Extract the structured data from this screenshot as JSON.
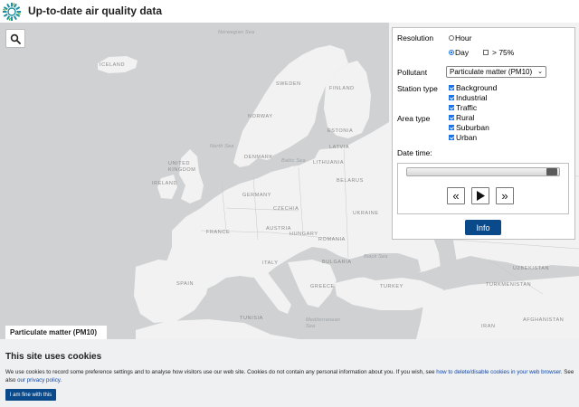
{
  "header": {
    "title": "Up-to-date air quality data"
  },
  "map": {
    "labels": {
      "iceland": "ICELAND",
      "sweden": "SWEDEN",
      "finland": "FINLAND",
      "norway": "NORWAY",
      "estonia": "ESTONIA",
      "latvia": "LATVIA",
      "lithuania": "LITHUANIA",
      "denmark": "DENMARK",
      "uk": "UNITED KINGDOM",
      "ireland": "IRELAND",
      "belarus": "BELARUS",
      "germany": "GERMANY",
      "czechia": "CZECHIA",
      "ukraine": "UKRAINE",
      "france": "FRANCE",
      "austria": "AUSTRIA",
      "hungary": "HUNGARY",
      "romania": "ROMANIA",
      "bulgaria": "BULGARIA",
      "spain": "SPAIN",
      "italy": "ITALY",
      "greece": "GREECE",
      "turkey": "TURKEY",
      "tunisia": "TUNISIA",
      "uzbekistan": "UZBEKISTAN",
      "turkmenistan": "TURKMENISTAN",
      "iran": "IRAN",
      "afghanistan": "AFGHANISTAN",
      "norwegian_sea": "Norwegian Sea",
      "north_sea": "North Sea",
      "baltic_sea": "Baltic Sea",
      "black_sea": "Black Sea",
      "mediterranean": "Mediterranean Sea"
    },
    "layer_label": "Particulate matter (PM10)"
  },
  "panel": {
    "resolution_label": "Resolution",
    "hour_label": "Hour",
    "day_label": "Day",
    "over75_label": "> 75%",
    "pollutant_label": "Pollutant",
    "pollutant_value": "Particulate matter (PM10)",
    "station_type_label": "Station type",
    "station_types": [
      "Background",
      "Industrial",
      "Traffic"
    ],
    "area_type_label": "Area type",
    "area_types": [
      "Rural",
      "Suburban",
      "Urban"
    ],
    "datetime_label": "Date time:",
    "slider_position": 1.0,
    "prev_label": "«",
    "play_label": "▶",
    "next_label": "»",
    "info_label": "Info",
    "resolution_selected": "Day",
    "over75_checked": false
  },
  "cookie": {
    "title": "This site uses cookies",
    "text_before": "We use cookies to record some preference settings and to analyse how visitors use our web site. Cookies do not contain any personal information about you. If you wish, see ",
    "link1": "how to delete/disable cookies in your web browser",
    "text_mid": ". See also ",
    "link2": "our privacy policy",
    "text_after": ".",
    "accept_label": "I am fine with this"
  },
  "colors": {
    "accent": "#0a4a8a",
    "map_water": "#cfd1d2",
    "map_land": "#f2f2f2",
    "cookie_bg": "#eef0f2"
  }
}
